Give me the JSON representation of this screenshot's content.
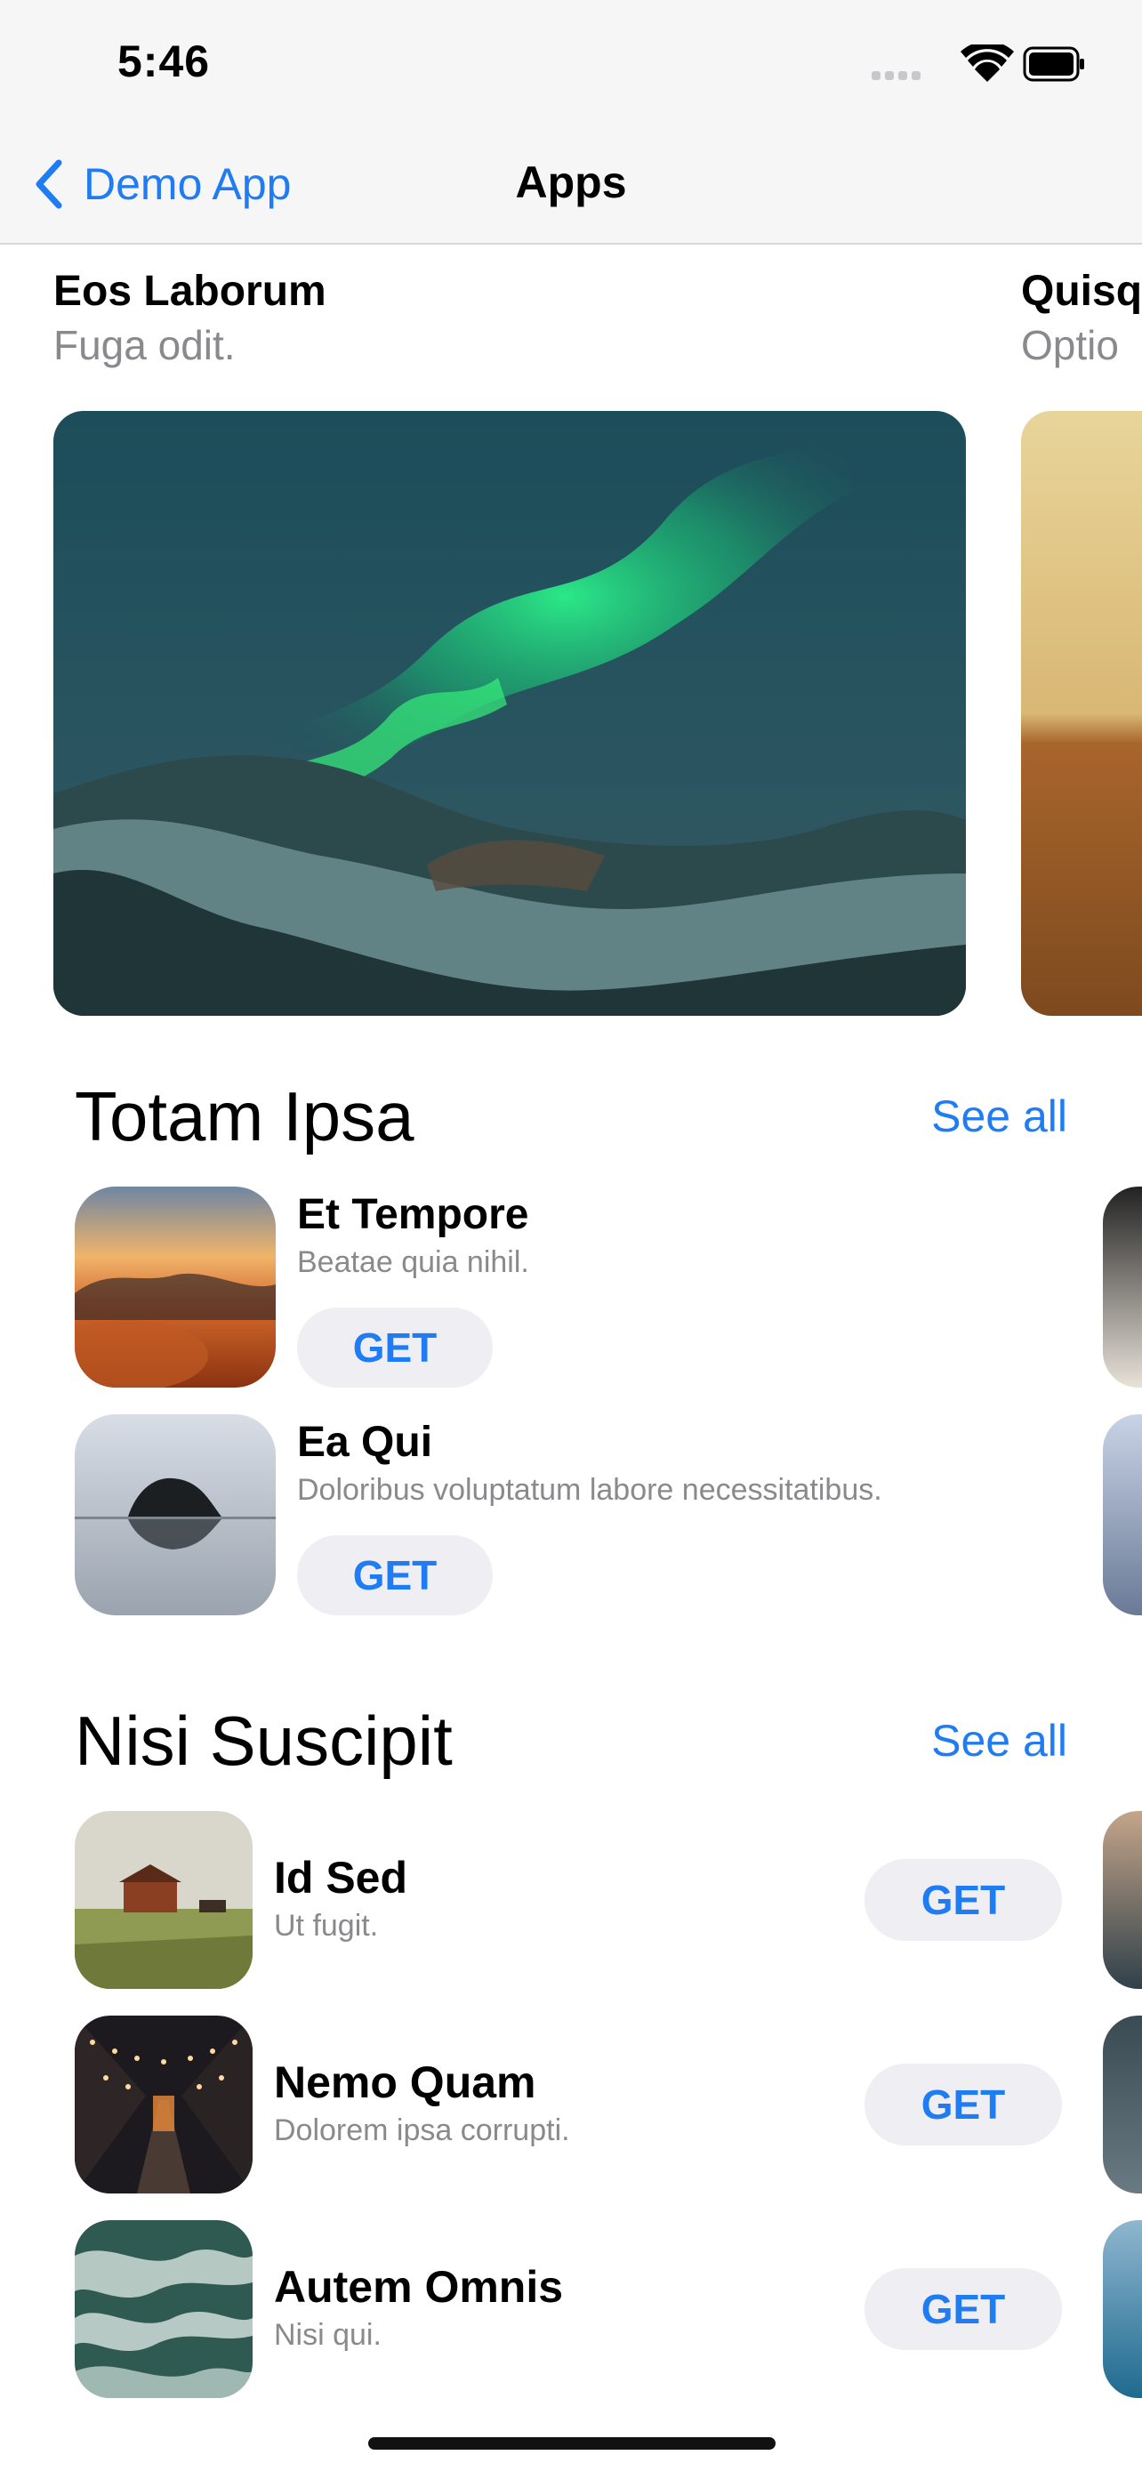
{
  "status_bar": {
    "time": "5:46"
  },
  "nav": {
    "back_label": "Demo App",
    "title": "Apps"
  },
  "featured": [
    {
      "title": "Eos Laborum",
      "subtitle": "Fuga odit.",
      "image": "aurora-over-snowy-mountains"
    },
    {
      "title": "Quisq",
      "subtitle": "Optio",
      "image": "desert-sand-dunes"
    }
  ],
  "sections": [
    {
      "title": "Totam Ipsa",
      "see_all": "See all",
      "apps": [
        {
          "name": "Et Tempore",
          "description": "Beatae quia nihil.",
          "button": "GET",
          "icon": "sunset-clouds-icon"
        },
        {
          "name": "Ea Qui",
          "description": "Doloribus voluptatum labore necessitatibus.",
          "button": "GET",
          "icon": "sea-rock-icon"
        }
      ]
    },
    {
      "title": "Nisi Suscipit",
      "see_all": "See all",
      "apps": [
        {
          "name": "Id Sed",
          "description": "Ut fugit.",
          "button": "GET",
          "icon": "farm-field-icon"
        },
        {
          "name": "Nemo Quam",
          "description": "Dolorem ipsa corrupti.",
          "button": "GET",
          "icon": "night-street-icon"
        },
        {
          "name": "Autem Omnis",
          "description": "Nisi qui.",
          "button": "GET",
          "icon": "ocean-waves-icon"
        }
      ]
    }
  ],
  "colors": {
    "accent": "#1f7cf2",
    "button_bg": "#eeeef3",
    "secondary_text": "#8a8a8e"
  }
}
